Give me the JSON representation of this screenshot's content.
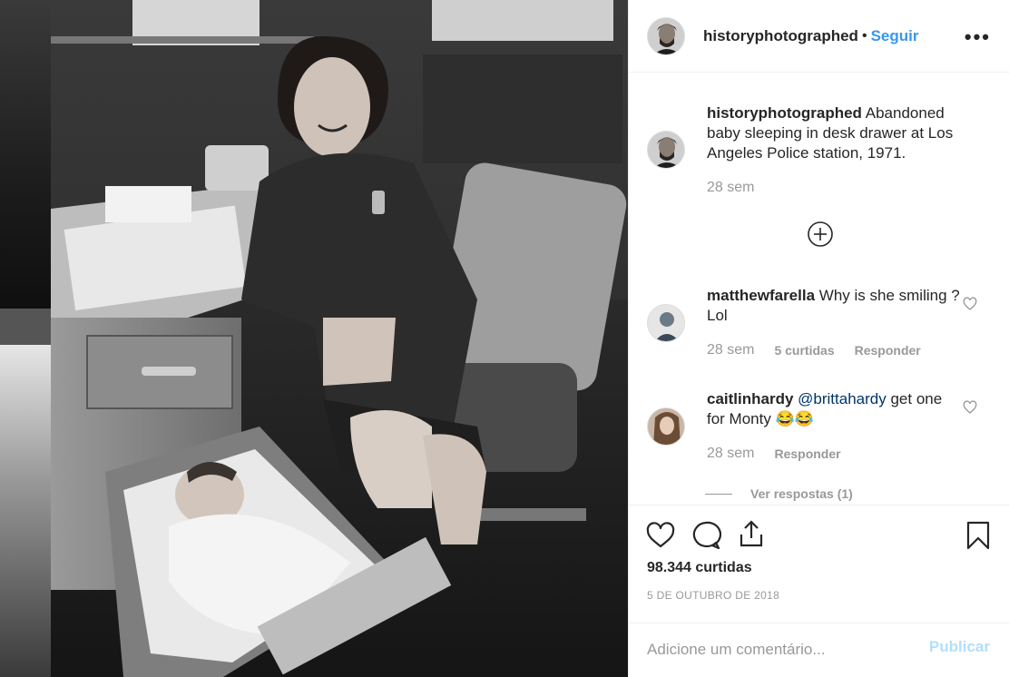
{
  "post": {
    "username": "historyphotographed",
    "follow_label": "Seguir",
    "more_label": "•••",
    "dot": "•"
  },
  "caption": {
    "username": "historyphotographed",
    "text": "Abandoned baby sleeping in desk drawer at Los Angeles Police station, 1971.",
    "time": "28 sem"
  },
  "comments": [
    {
      "username": "matthewfarella",
      "text": "Why is she smiling ? Lol",
      "time": "28 sem",
      "likes": "5 curtidas",
      "reply": "Responder"
    },
    {
      "username": "caitlinhardy",
      "mention": "@brittahardy",
      "text": "get one for Monty 😂😂",
      "time": "28 sem",
      "reply": "Responder",
      "view_replies": "Ver respostas (1)"
    }
  ],
  "actions": {
    "likes": "98.344 curtidas",
    "date": "5 DE OUTUBRO DE 2018"
  },
  "add_comment": {
    "placeholder": "Adicione um comentário...",
    "publish": "Publicar"
  },
  "colors": {
    "link_blue": "#3897f0",
    "publish_disabled": "#b2dffc",
    "muted": "#999999",
    "text": "#262626"
  }
}
